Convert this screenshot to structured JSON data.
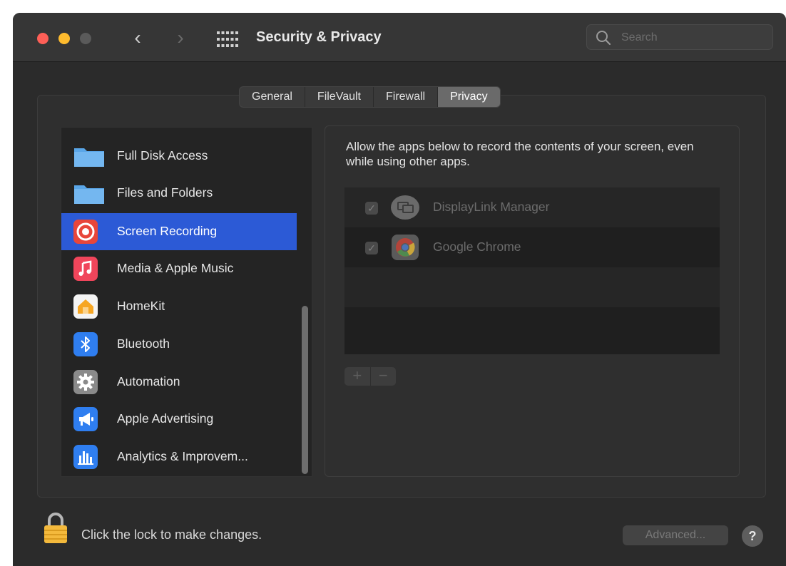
{
  "window": {
    "title": "Security & Privacy",
    "search_placeholder": "Search"
  },
  "tabs": [
    {
      "label": "General",
      "active": false
    },
    {
      "label": "FileVault",
      "active": false
    },
    {
      "label": "Firewall",
      "active": false
    },
    {
      "label": "Privacy",
      "active": true
    }
  ],
  "sidebar": {
    "items": [
      {
        "label": "Full Disk Access",
        "icon": "folder-icon",
        "selected": false
      },
      {
        "label": "Files and Folders",
        "icon": "folder-icon",
        "selected": false
      },
      {
        "label": "Screen Recording",
        "icon": "screen-recording-icon",
        "selected": true
      },
      {
        "label": "Media & Apple Music",
        "icon": "music-icon",
        "selected": false
      },
      {
        "label": "HomeKit",
        "icon": "home-icon",
        "selected": false
      },
      {
        "label": "Bluetooth",
        "icon": "bluetooth-icon",
        "selected": false
      },
      {
        "label": "Automation",
        "icon": "gear-icon",
        "selected": false
      },
      {
        "label": "Apple Advertising",
        "icon": "megaphone-icon",
        "selected": false
      },
      {
        "label": "Analytics & Improvem...",
        "icon": "bar-chart-icon",
        "selected": false
      }
    ]
  },
  "panel": {
    "description": "Allow the apps below to record the contents of your screen, even while using other apps.",
    "apps": [
      {
        "name": "DisplayLink Manager",
        "checked": true,
        "icon": "displaylink-icon"
      },
      {
        "name": "Google Chrome",
        "checked": true,
        "icon": "chrome-icon"
      }
    ],
    "add_label": "+",
    "remove_label": "−"
  },
  "footer": {
    "lock_text": "Click the lock to make changes.",
    "advanced_label": "Advanced...",
    "help_label": "?"
  },
  "colors": {
    "selection": "#2c5ad6",
    "window_bg": "#2b2b2b"
  }
}
